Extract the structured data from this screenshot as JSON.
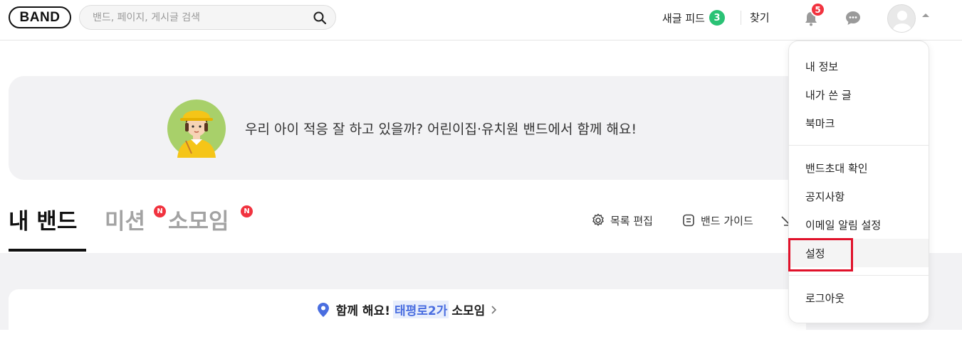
{
  "header": {
    "logo_text": "BAND",
    "search_placeholder": "밴드, 페이지, 게시글 검색",
    "feed_label": "새글 피드",
    "feed_count": "3",
    "find_label": "찾기",
    "notification_count": "5"
  },
  "banner": {
    "text": "우리 아이 적응 잘 하고 있을까? 어린이집·유치원 밴드에서 함께 해요!"
  },
  "tabs": {
    "mine": "내 밴드",
    "mission": "미션",
    "small_group": "소모임",
    "new_badge": "N"
  },
  "tools": {
    "edit_list": "목록 편집",
    "band_guide": "밴드 가이드"
  },
  "card": {
    "prefix": "함께 해요!",
    "location": "태평로2가",
    "suffix": "소모임"
  },
  "dropdown": {
    "items": [
      "내 정보",
      "내가 쓴 글",
      "북마크",
      "밴드초대 확인",
      "공지사항",
      "이메일 알림 설정",
      "설정",
      "로그아웃"
    ]
  },
  "colors": {
    "feed_badge": "#2ac275",
    "alert_badge": "#f1333f",
    "highlight": "#4a6ee0",
    "annotation_box": "#e0112a"
  }
}
